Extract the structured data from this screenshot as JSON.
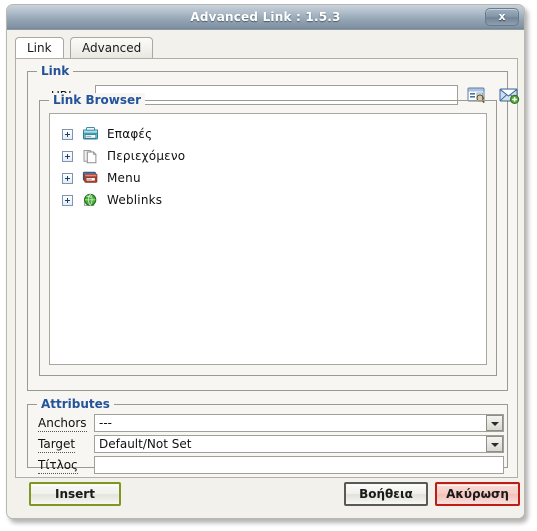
{
  "window": {
    "title": "Advanced Link : 1.5.3",
    "close_label": "x"
  },
  "tabs": [
    {
      "label": "Link",
      "active": true
    },
    {
      "label": "Advanced",
      "active": false
    }
  ],
  "link_fieldset": {
    "legend": "Link",
    "url": {
      "label": "URL",
      "value": "",
      "placeholder": ""
    },
    "browse_icon": "browse-page-icon",
    "email_icon": "new-email-icon"
  },
  "link_browser": {
    "legend": "Link Browser",
    "items": [
      {
        "label": "Επαφές",
        "icon": "contacts-icon",
        "expander": "plus"
      },
      {
        "label": "Περιεχόμενο",
        "icon": "content-pages-icon",
        "expander": "plus"
      },
      {
        "label": "Menu",
        "icon": "menu-stack-icon",
        "expander": "plus"
      },
      {
        "label": "Weblinks",
        "icon": "globe-icon",
        "expander": "plus"
      }
    ]
  },
  "attributes": {
    "legend": "Attributes",
    "anchors": {
      "label": "Anchors",
      "value": "---"
    },
    "target": {
      "label": "Target",
      "value": "Default/Not Set"
    },
    "title": {
      "label": "Τίτλος",
      "value": "",
      "placeholder": ""
    }
  },
  "buttons": {
    "insert": "Insert",
    "help": "Βοήθεια",
    "cancel": "Ακύρωση"
  },
  "colors": {
    "legend_blue": "#24539c",
    "insert_border": "#7f9622",
    "cancel_border": "#c11b15",
    "titlebar_top": "#c8d2dc",
    "titlebar_bottom": "#6e808f"
  }
}
